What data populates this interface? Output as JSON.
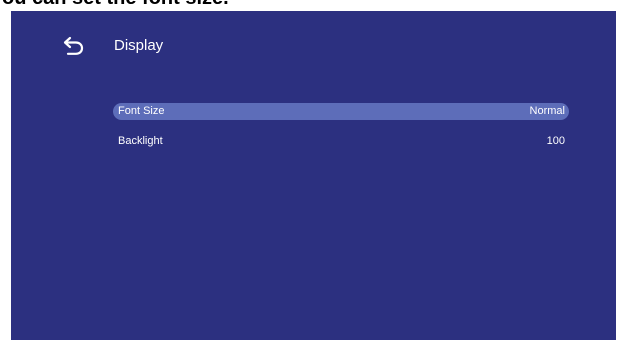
{
  "caption": {
    "text": "ou can set the font size."
  },
  "header": {
    "back_icon": "back-arrow-icon",
    "title": "Display"
  },
  "settings": [
    {
      "label": "Font Size",
      "value": "Normal",
      "selected": true
    },
    {
      "label": "Backlight",
      "value": "100",
      "selected": false
    }
  ],
  "colors": {
    "background": "#2c3080",
    "highlight": "#5d6db9",
    "text": "#ffffff"
  }
}
